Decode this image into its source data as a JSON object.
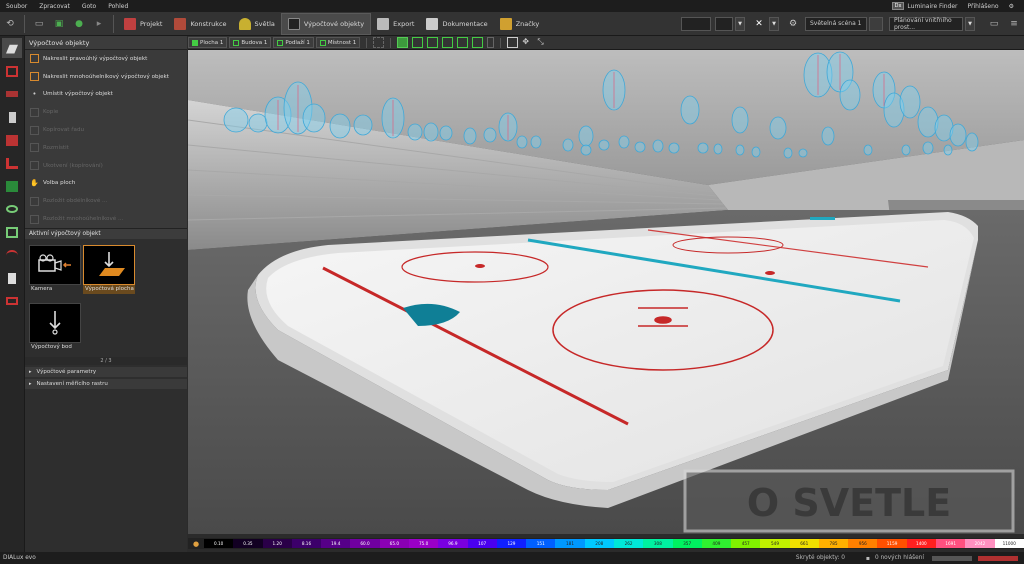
{
  "menu": {
    "items": [
      "Soubor",
      "Zpracovat",
      "Goto",
      "Pohled"
    ],
    "luminaire_finder_badge": "Dx",
    "luminaire_finder": "Luminaire Finder",
    "login": "Přihlášeno"
  },
  "toolbar": {
    "tabs": [
      {
        "label": "Projekt"
      },
      {
        "label": "Konstrukce"
      },
      {
        "label": "Světla"
      },
      {
        "label": "Výpočtové objekty"
      },
      {
        "label": "Export"
      },
      {
        "label": "Dokumentace"
      },
      {
        "label": "Značky"
      }
    ],
    "light_scene": "Světelná scéna 1",
    "planning_view": "Plánování vnitřního prost..."
  },
  "panel": {
    "title": "Výpočtové objekty",
    "actions": [
      {
        "label": "Nakreslit pravoúhlý výpočtový objekt",
        "enabled": true
      },
      {
        "label": "Nakreslit mnohoúhelníkový výpočtový objekt",
        "enabled": true
      },
      {
        "label": "Umístit výpočtový objekt",
        "enabled": true
      },
      {
        "label": "Kopie",
        "enabled": false
      },
      {
        "label": "Kopírovat řadu",
        "enabled": false
      },
      {
        "label": "Rozmístit",
        "enabled": false
      },
      {
        "label": "Ukotvení (kopírování)",
        "enabled": false
      },
      {
        "label": "Volba ploch",
        "enabled": true
      },
      {
        "label": "Rozložit obdélníkové ...",
        "enabled": false
      },
      {
        "label": "Rozložit mnohoúhelníkové ...",
        "enabled": false
      }
    ],
    "active_objects_header": "Aktivní výpočtový objekt",
    "objects": [
      {
        "label": "Kamera"
      },
      {
        "label": "Výpočtová plocha"
      },
      {
        "label": "Výpočtový bod"
      }
    ],
    "scroll_label": "2 / 3",
    "sections": [
      "Výpočtové parametry",
      "Nastavení měřícího rastru"
    ]
  },
  "viewport_bar": {
    "crumbs": [
      "Plocha 1",
      "Budova 1",
      "Podlaží 1",
      "Místnost 1"
    ]
  },
  "scale": {
    "values": [
      "0.10",
      "0.35",
      "1.20",
      "8.16",
      "19.4",
      "60.0",
      "65.0",
      "75.0",
      "96.9",
      "107",
      "129",
      "151",
      "181",
      "208",
      "262",
      "308",
      "357",
      "409",
      "457",
      "549",
      "661",
      "785",
      "956",
      "1159",
      "1400",
      "1691",
      "2042",
      "11000"
    ],
    "colors": [
      "#000000",
      "#120022",
      "#2a0048",
      "#3c006a",
      "#560088",
      "#7000a0",
      "#8a00b4",
      "#9a00c8",
      "#7a00e0",
      "#4a00f0",
      "#1020ff",
      "#0060ff",
      "#0098ff",
      "#00c8ff",
      "#00e8d8",
      "#00f0a0",
      "#00f060",
      "#30f030",
      "#80f000",
      "#c0f000",
      "#f0e000",
      "#ffb000",
      "#ff8000",
      "#ff5000",
      "#ff2020",
      "#ff5080",
      "#ff90c0",
      "#ffffff"
    ]
  },
  "status": {
    "brand": "DIALux evo",
    "hidden_objects": "Skryté objekty: 0",
    "messages": "0 nových hlášení"
  },
  "watermark": "O SVETLE"
}
